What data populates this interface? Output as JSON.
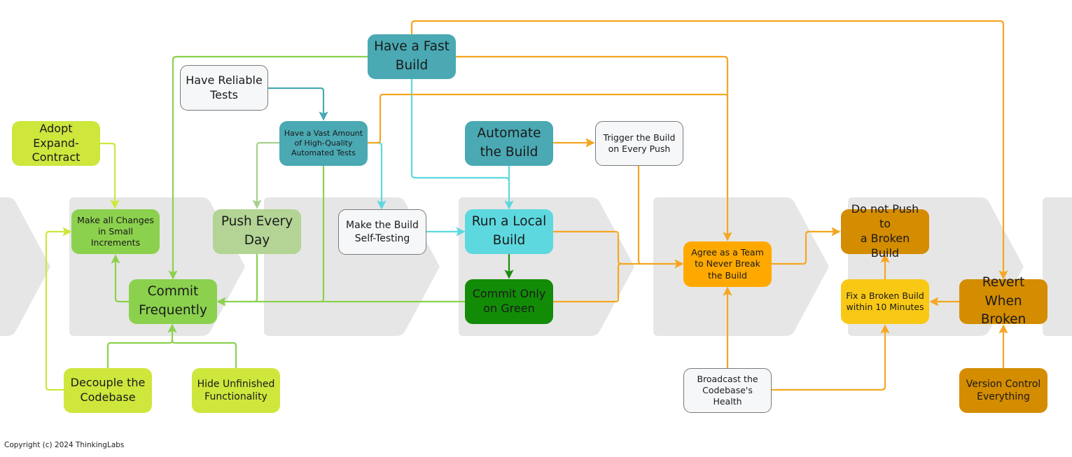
{
  "colors": {
    "chevron": "#e6e6e6",
    "lime": "#cfe63d",
    "green_light": "#8bd14e",
    "green_sage": "#b3d495",
    "green_dark": "#128c07",
    "teal": "#4aa9b3",
    "cyan": "#5dd8df",
    "white_node": "#f6f7f9",
    "orange": "#ffa900",
    "orange_dark": "#d48c00",
    "yellow": "#f8c815",
    "edge_orange": "#f5a623",
    "edge_green": "#8bd14e",
    "edge_lime": "#cfe63d",
    "edge_sage": "#a8d08d",
    "edge_teal": "#4aa9b3",
    "edge_cyan": "#5dd8df",
    "edge_darkgreen": "#1e8c10"
  },
  "nodes": [
    {
      "id": "adopt-expand-contract",
      "label": "Adopt Expand-\nContract",
      "fill": "lime"
    },
    {
      "id": "make-small-changes",
      "label": "Make all Changes\nin Small\nIncrements",
      "fill": "green_light"
    },
    {
      "id": "commit-frequently",
      "label": "Commit\nFrequently",
      "fill": "green_light"
    },
    {
      "id": "decouple-codebase",
      "label": "Decouple the\nCodebase",
      "fill": "lime"
    },
    {
      "id": "hide-unfinished",
      "label": "Hide Unfinished\nFunctionality",
      "fill": "lime"
    },
    {
      "id": "push-every-day",
      "label": "Push Every\nDay",
      "fill": "green_sage"
    },
    {
      "id": "have-reliable-tests",
      "label": "Have Reliable\nTests",
      "fill": "white_node"
    },
    {
      "id": "vast-automated-tests",
      "label": "Have a Vast Amount\nof  High-Quality\nAutomated Tests",
      "fill": "teal"
    },
    {
      "id": "have-fast-build",
      "label": "Have a Fast\nBuild",
      "fill": "teal"
    },
    {
      "id": "make-build-self-testing",
      "label": "Make the Build\nSelf-Testing",
      "fill": "white_node"
    },
    {
      "id": "automate-build",
      "label": "Automate\nthe Build",
      "fill": "teal"
    },
    {
      "id": "run-local-build",
      "label": "Run a Local\nBuild",
      "fill": "cyan"
    },
    {
      "id": "commit-only-green",
      "label": "Commit Only\non Green",
      "fill": "green_dark"
    },
    {
      "id": "trigger-build-every-push",
      "label": "Trigger the Build\non Every Push",
      "fill": "white_node"
    },
    {
      "id": "agree-never-break",
      "label": "Agree as a Team\nto Never Break\nthe Build",
      "fill": "orange"
    },
    {
      "id": "broadcast-health",
      "label": "Broadcast the\nCodebase's\nHealth",
      "fill": "white_node"
    },
    {
      "id": "do-not-push-broken",
      "label": "Do not Push to\na Broken Build",
      "fill": "orange_dark"
    },
    {
      "id": "fix-broken-10-min",
      "label": "Fix a Broken Build\nwithin 10 Minutes",
      "fill": "yellow"
    },
    {
      "id": "revert-when-broken",
      "label": "Revert When\nBroken",
      "fill": "orange_dark"
    },
    {
      "id": "version-control-everything",
      "label": "Version Control\nEverything",
      "fill": "orange_dark"
    }
  ],
  "edges": [
    {
      "from": "adopt-expand-contract",
      "to": "make-small-changes",
      "color": "edge_lime"
    },
    {
      "from": "decouple-codebase",
      "to": "make-small-changes",
      "color": "edge_lime"
    },
    {
      "from": "commit-frequently",
      "to": "make-small-changes",
      "color": "edge_green"
    },
    {
      "from": "have-fast-build",
      "to": "commit-frequently",
      "color": "edge_green"
    },
    {
      "from": "push-every-day",
      "to": "commit-frequently",
      "color": "edge_green"
    },
    {
      "from": "vast-automated-tests",
      "to": "commit-frequently",
      "color": "edge_green"
    },
    {
      "from": "commit-only-green",
      "to": "commit-frequently",
      "color": "edge_green"
    },
    {
      "from": "decouple-codebase",
      "to": "commit-frequently",
      "color": "edge_green"
    },
    {
      "from": "hide-unfinished",
      "to": "commit-frequently",
      "color": "edge_green"
    },
    {
      "from": "vast-automated-tests",
      "to": "push-every-day",
      "color": "edge_sage"
    },
    {
      "from": "have-reliable-tests",
      "to": "vast-automated-tests",
      "color": "edge_teal"
    },
    {
      "from": "vast-automated-tests",
      "to": "make-build-self-testing",
      "color": "edge_cyan"
    },
    {
      "from": "make-build-self-testing",
      "to": "run-local-build",
      "color": "edge_cyan"
    },
    {
      "from": "have-fast-build",
      "to": "run-local-build",
      "color": "edge_cyan"
    },
    {
      "from": "automate-build",
      "to": "run-local-build",
      "color": "edge_cyan"
    },
    {
      "from": "run-local-build",
      "to": "commit-only-green",
      "color": "edge_darkgreen"
    },
    {
      "from": "automate-build",
      "to": "trigger-build-every-push",
      "color": "edge_orange"
    },
    {
      "from": "run-local-build",
      "to": "agree-never-break",
      "color": "edge_orange"
    },
    {
      "from": "commit-only-green",
      "to": "agree-never-break",
      "color": "edge_orange"
    },
    {
      "from": "trigger-build-every-push",
      "to": "agree-never-break",
      "color": "edge_orange"
    },
    {
      "from": "have-fast-build",
      "to": "agree-never-break",
      "color": "edge_orange"
    },
    {
      "from": "vast-automated-tests",
      "to": "agree-never-break",
      "color": "edge_orange"
    },
    {
      "from": "broadcast-health",
      "to": "agree-never-break",
      "color": "edge_orange"
    },
    {
      "from": "agree-never-break",
      "to": "do-not-push-broken",
      "color": "edge_orange"
    },
    {
      "from": "fix-broken-10-min",
      "to": "do-not-push-broken",
      "color": "edge_orange"
    },
    {
      "from": "broadcast-health",
      "to": "fix-broken-10-min",
      "color": "edge_orange"
    },
    {
      "from": "revert-when-broken",
      "to": "fix-broken-10-min",
      "color": "edge_orange"
    },
    {
      "from": "have-fast-build",
      "to": "revert-when-broken",
      "color": "edge_orange"
    },
    {
      "from": "version-control-everything",
      "to": "revert-when-broken",
      "color": "edge_orange"
    }
  ],
  "footer": {
    "copyright": "Copyright (c) 2024 ThinkingLabs"
  }
}
